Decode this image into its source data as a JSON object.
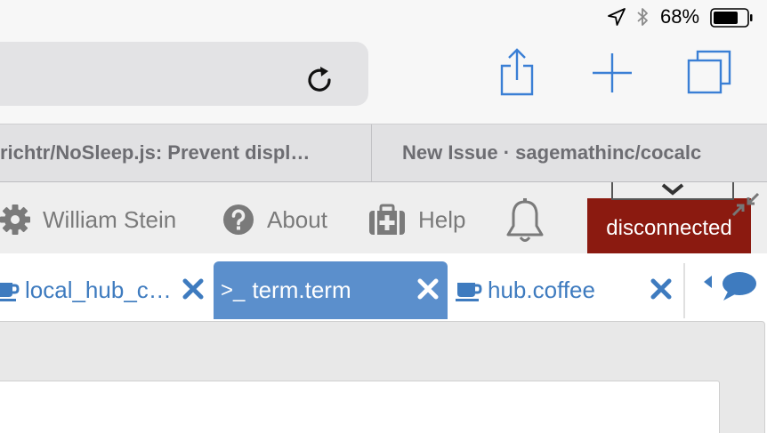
{
  "status_bar": {
    "battery_percent": "68%",
    "battery_level": 0.68,
    "icons": [
      "location-arrow-icon",
      "bluetooth-icon",
      "battery-icon"
    ]
  },
  "toolbar": {
    "icons": [
      "reload-icon",
      "share-icon",
      "new-tab-plus-icon",
      "tabs-overview-icon"
    ],
    "accent_color": "#3a7fd5"
  },
  "browser_tabs": [
    {
      "label": "richtr/NoSleep.js: Prevent displ…"
    },
    {
      "label": "New Issue · sagemathinc/cocalc"
    }
  ],
  "cocalc_bar": {
    "user_name": "William Stein",
    "about_label": "About",
    "help_label": "Help",
    "connection_status": "disconnected",
    "status_color": "#8b1a10"
  },
  "file_tabs": [
    {
      "label": "local_hub_c…",
      "icon": "coffee-cup-icon",
      "active": false
    },
    {
      "label": "term.term",
      "prefix": ">_",
      "icon": "terminal-icon",
      "active": true
    },
    {
      "label": "hub.coffee",
      "icon": "coffee-cup-icon",
      "active": false
    }
  ]
}
